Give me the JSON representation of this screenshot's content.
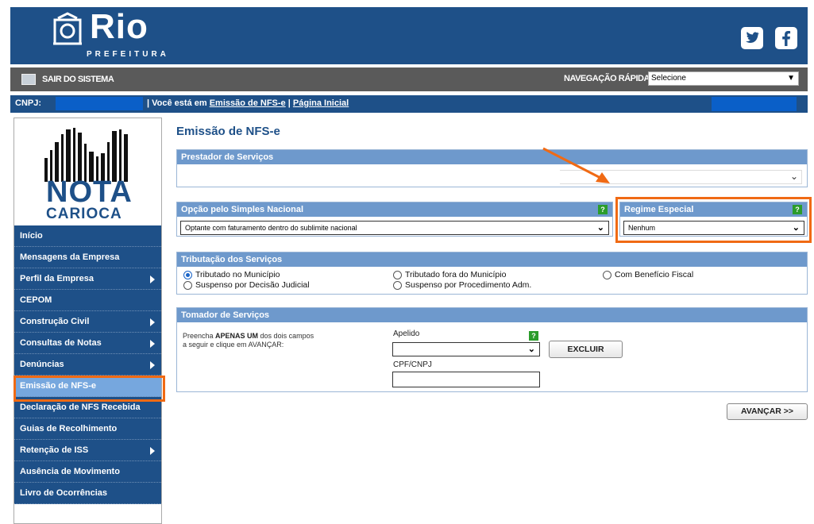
{
  "header": {
    "logo_text": "Rio",
    "logo_sub": "PREFEITURA"
  },
  "sysbar": {
    "exit_label": "SAIR DO SISTEMA",
    "quicknav_label": "NAVEGAÇÃO RÁPIDA",
    "quicknav_value": "Selecione"
  },
  "breadcrumb": {
    "cnpj_label": "CNPJ:",
    "prefix": "| Você está em",
    "link1": "Emissão de NFS-e",
    "sep": "|",
    "link2": "Página Inicial"
  },
  "sidebar": {
    "logo_line1": "NOTA",
    "logo_line2": "CARIOCA",
    "items": [
      {
        "label": "Início",
        "arrow": false
      },
      {
        "label": "Mensagens da Empresa",
        "arrow": false
      },
      {
        "label": "Perfil da Empresa",
        "arrow": true
      },
      {
        "label": "CEPOM",
        "arrow": false
      },
      {
        "label": "Construção Civil",
        "arrow": true
      },
      {
        "label": "Consultas de Notas",
        "arrow": true
      },
      {
        "label": "Denúncias",
        "arrow": true
      },
      {
        "label": "Emissão de NFS-e",
        "arrow": false,
        "active": true
      },
      {
        "label": "Declaração de NFS Recebida",
        "arrow": false
      },
      {
        "label": "Guias de Recolhimento",
        "arrow": false
      },
      {
        "label": "Retenção de ISS",
        "arrow": true
      },
      {
        "label": "Ausência de Movimento",
        "arrow": false
      },
      {
        "label": "Livro de Ocorrências",
        "arrow": false
      }
    ]
  },
  "main": {
    "title": "Emissão de NFS-e",
    "prestador": {
      "header": "Prestador de Serviços"
    },
    "simples": {
      "header": "Opção pelo Simples Nacional",
      "value": "Optante com faturamento dentro do sublimite nacional"
    },
    "regime": {
      "header": "Regime Especial",
      "value": "Nenhum"
    },
    "help_glyph": "?",
    "tributacao": {
      "header": "Tributação dos Serviços",
      "options": [
        "Tributado no Município",
        "Suspenso por Decisão Judicial",
        "Tributado fora do Município",
        "Suspenso por Procedimento Adm.",
        "Com Benefício Fiscal"
      ],
      "selected": "Tributado no Município"
    },
    "tomador": {
      "header": "Tomador de Serviços",
      "instr_pre": "Preencha ",
      "instr_bold": "APENAS UM",
      "instr_post": " dos dois campos",
      "instr_line2": "a seguir e clique em AVANÇAR:",
      "apelido_label": "Apelido",
      "cpf_label": "CPF/CNPJ",
      "excluir_label": "EXCLUIR"
    },
    "avancar_label": "AVANÇAR >>"
  },
  "colors": {
    "header_blue": "#1e5088",
    "panel_header": "#6e99cc",
    "highlight_orange": "#f06a14",
    "active_menu": "#76a7de"
  }
}
